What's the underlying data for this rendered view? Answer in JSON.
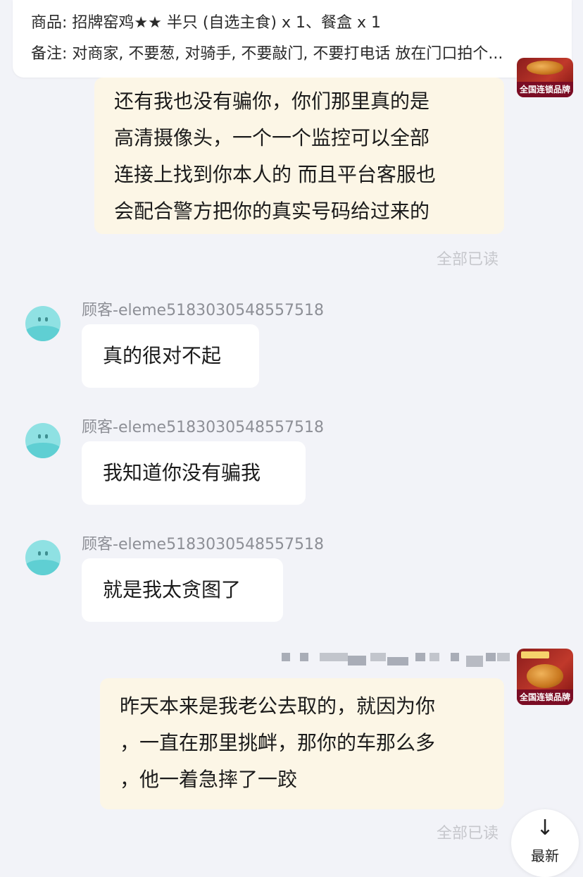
{
  "order": {
    "items_line": "商品: 招牌窑鸡★★ 半只 (自选主食) x 1、餐盒 x 1",
    "remark_line": "备注: 对商家, 不要葱, 对骑手, 不要敲门, 不要打电话 放在门口拍个..."
  },
  "merchant": {
    "brand_badge": "全国连锁品牌",
    "avatar_icon": "roast-chicken-logo"
  },
  "messages": [
    {
      "sender": "merchant",
      "lines": [
        "还有我也没有骗你，你们那里真的是",
        "高清摄像头，一个一个监控可以全部",
        "连接上找到你本人的 而且平台客服也",
        "会配合警方把你的真实号码给过来的"
      ],
      "status": "全部已读"
    },
    {
      "sender": "customer",
      "name": "顾客-eleme5183030548557518",
      "text": "真的很对不起"
    },
    {
      "sender": "customer",
      "name": "顾客-eleme5183030548557518",
      "text": "我知道你没有骗我"
    },
    {
      "sender": "customer",
      "name": "顾客-eleme5183030548557518",
      "text": "就是我太贪图了"
    },
    {
      "sender": "merchant",
      "lines": [
        "昨天本来是我老公去取的，就因为你",
        "，一直在那里挑衅，那你的车那么多",
        "，他一着急摔了一跤"
      ],
      "status": "全部已读"
    }
  ],
  "jump_button": {
    "arrow": "↓",
    "label": "最新"
  },
  "colors": {
    "page_bg": "#f2f3f8",
    "merchant_bubble": "#fcf6e6",
    "customer_bubble": "#ffffff",
    "read_status": "#c6c7cc",
    "customer_avatar": "#8fe1e3",
    "brand_badge_bg": "#7a0c24"
  }
}
